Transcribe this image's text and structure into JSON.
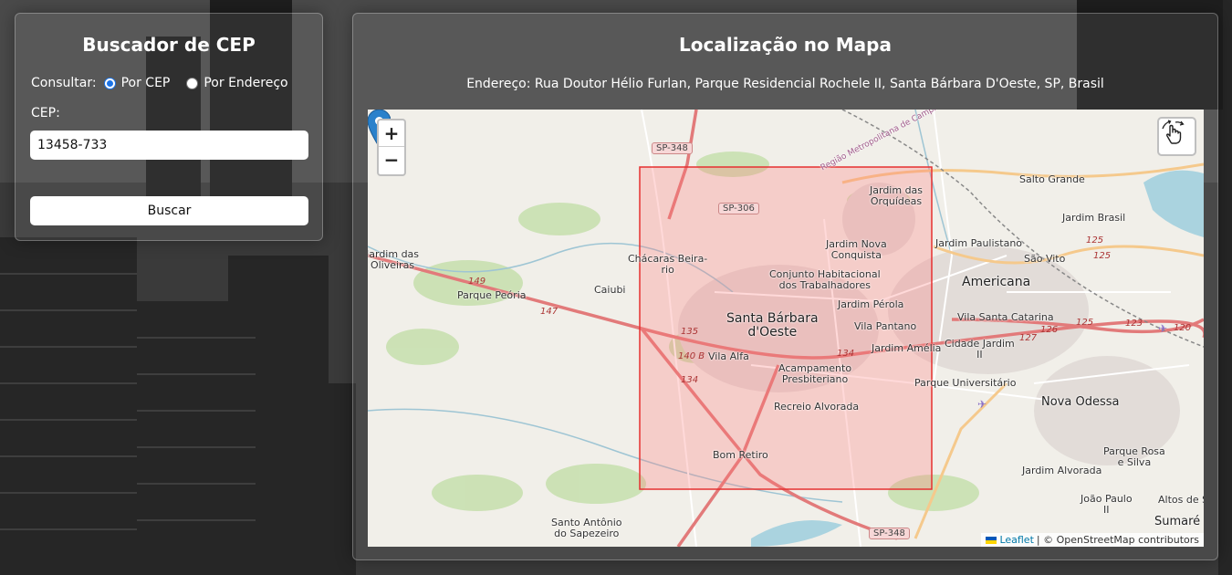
{
  "left_panel": {
    "title": "Buscador de CEP",
    "consult_label": "Consultar:",
    "option_cep": "Por CEP",
    "option_address": "Por Endereço",
    "cep_label": "CEP:",
    "cep_value": "13458-733",
    "search_button": "Buscar"
  },
  "right_panel": {
    "title": "Localização no Mapa",
    "address": "Endereço: Rua Doutor Hélio Furlan, Parque Residencial Rochele II, Santa Bárbara D'Oeste, SP, Brasil"
  },
  "map": {
    "zoom_in": "+",
    "zoom_out": "−",
    "attribution_link": "Leaflet",
    "attribution_text": "| © OpenStreetMap contributors",
    "labels": {
      "santa_barbara_1": "Santa Bárbara",
      "santa_barbara_2": "d'Oeste",
      "americana": "Americana",
      "nova_odessa": "Nova Odessa",
      "sumare": "Sumaré",
      "salto_grande": "Salto Grande",
      "jardim_brasil": "Jardim Brasil",
      "jardim_paulistano": "Jardim Paulistano",
      "sao_vito": "São Vito",
      "jardim_orquideas_1": "Jardim das",
      "jardim_orquideas_2": "Orquídeas",
      "jardim_nova_1": "Jardim Nova",
      "jardim_nova_2": "Conquista",
      "conjunto_1": "Conjunto Habitacional",
      "conjunto_2": "dos Trabalhadores",
      "jardim_perola": "Jardim Pérola",
      "vila_pantano": "Vila Pantano",
      "jardim_amelia": "Jardim Amélia",
      "vila_santa_catarina": "Vila Santa Catarina",
      "cidade_jardim_1": "Cidade Jardim",
      "cidade_jardim_2": "II",
      "parque_universitario": "Parque Universitário",
      "vila_alfa": "Vila Alfa",
      "acampamento_1": "Acampamento",
      "acampamento_2": "Presbiteriano",
      "recreio_alvorada": "Recreio Alvorada",
      "bom_retiro": "Bom Retiro",
      "chacaras_1": "Chácaras Beira-",
      "chacaras_2": "rio",
      "parque_peoria": "Parque Peória",
      "caiubi": "Caiubi",
      "jardim_oliveiras_1": "Jardim das",
      "jardim_oliveiras_2": "Oliveiras",
      "santo_antonio_1": "Santo Antônio",
      "santo_antonio_2": "do Sapezeiro",
      "parque_rosa_1": "Parque Rosa",
      "parque_rosa_2": "e Silva",
      "jardim_alvorada": "Jardim Alvorada",
      "joao_paulo_1": "João Paulo",
      "joao_paulo_2": "II",
      "altos_1": "Altos de S",
      "regiao_metro": "Região Metropolitana de Campinas"
    },
    "shields": {
      "sp348_top": "SP-348",
      "sp306": "SP-306",
      "sp348_bottom": "SP-348"
    },
    "road_numbers": {
      "r149": "149",
      "r147": "147",
      "r135": "135",
      "r140b": "140 B",
      "r134a": "134",
      "r134b": "134",
      "r125a": "125",
      "r125b": "125",
      "r125c": "125",
      "r127": "127",
      "r126": "126",
      "r123": "123",
      "r120": "120"
    }
  }
}
